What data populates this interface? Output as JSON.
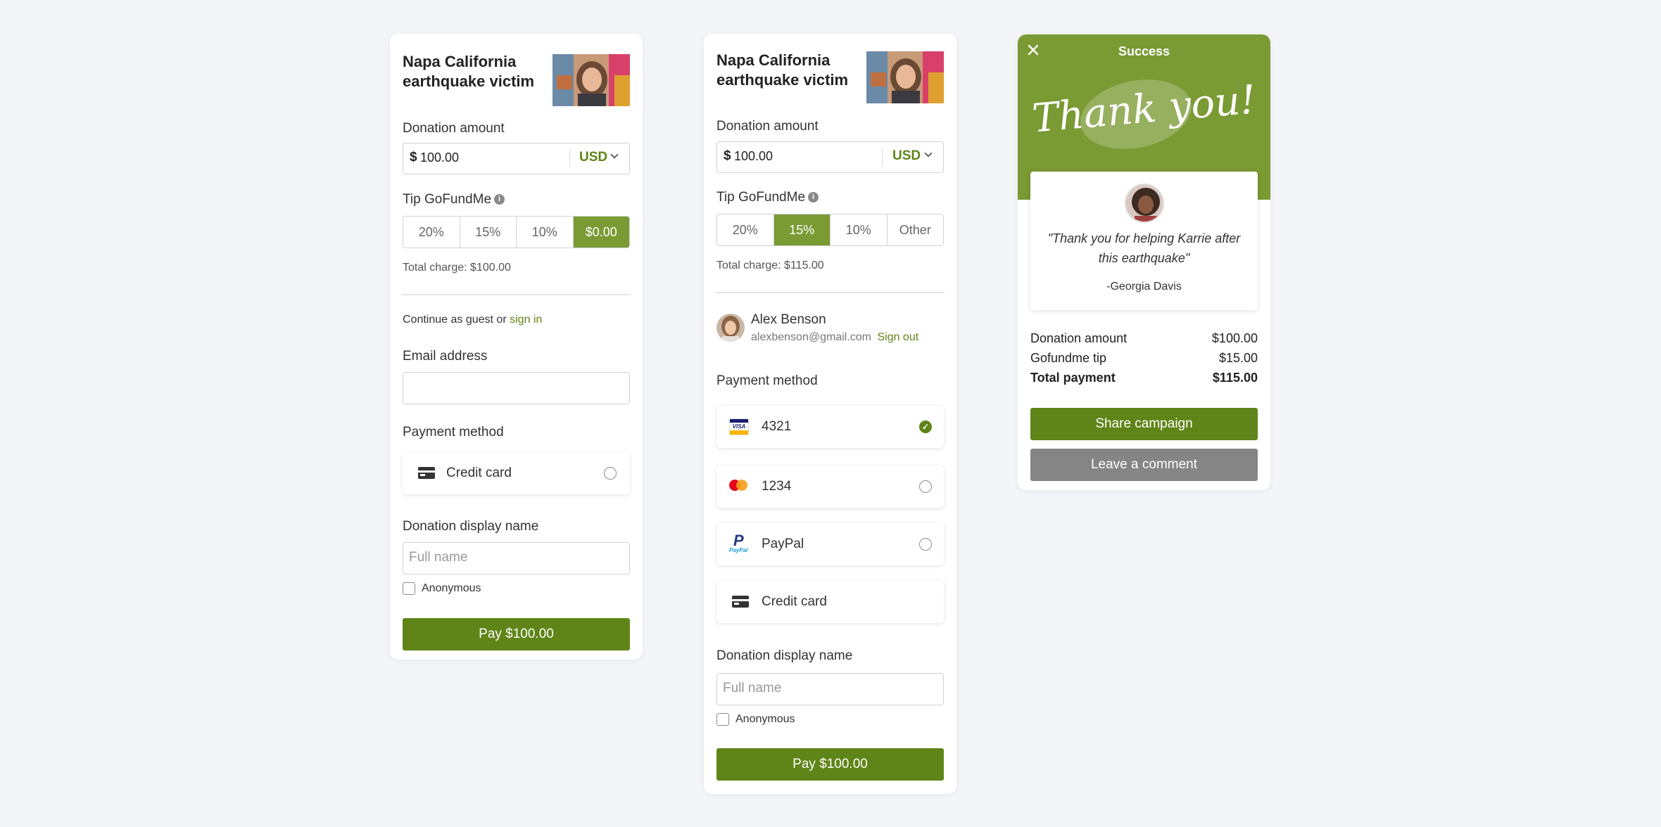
{
  "panel1": {
    "title_line1": "Napa California",
    "title_line2": "earthquake victim",
    "donation_label": "Donation amount",
    "currency_symbol": "$",
    "amount": "100.00",
    "currency": "USD",
    "tip_label": "Tip GoFundMe",
    "tips": [
      "20%",
      "15%",
      "10%",
      "$0.00"
    ],
    "selected_tip": 3,
    "total_charge": "Total charge: $100.00",
    "continue_text": "Continue as guest or",
    "sign_in": "sign in",
    "email_label": "Email address",
    "email_value": "",
    "payment_label": "Payment method",
    "payment_option": "Credit card",
    "display_name_label": "Donation display name",
    "full_name_placeholder": "Full name",
    "anonymous": "Anonymous",
    "pay_button": "Pay $100.00"
  },
  "panel2": {
    "title_line1": "Napa California",
    "title_line2": "earthquake victim",
    "donation_label": "Donation amount",
    "currency_symbol": "$",
    "amount": "100.00",
    "currency": "USD",
    "tip_label": "Tip GoFundMe",
    "tips": [
      "20%",
      "15%",
      "10%",
      "Other"
    ],
    "selected_tip": 1,
    "total_charge": "Total charge: $115.00",
    "user_name": "Alex Benson",
    "user_email": "alexbenson@gmail.com",
    "sign_out": "Sign out",
    "payment_label": "Payment method",
    "payment_methods": [
      {
        "label": "4321",
        "icon": "visa-icon",
        "selected": true
      },
      {
        "label": "1234",
        "icon": "mastercard-icon",
        "selected": false
      },
      {
        "label": "PayPal",
        "icon": "paypal-icon",
        "selected": false
      },
      {
        "label": "Credit card",
        "icon": "credit-card-icon",
        "selected": false
      }
    ],
    "display_name_label": "Donation display name",
    "full_name_placeholder": "Full name",
    "anonymous": "Anonymous",
    "pay_button": "Pay $100.00"
  },
  "panel3": {
    "header_title": "Success",
    "thank_you": "Thank you!",
    "quote": "\"Thank you for helping Karrie after this earthquake\"",
    "quote_author": "-Georgia Davis",
    "summary": [
      {
        "label": "Donation amount",
        "value": "$100.00"
      },
      {
        "label": "Gofundme tip",
        "value": "$15.00"
      },
      {
        "label": "Total payment",
        "value": "$115.00"
      }
    ],
    "share_button": "Share campaign",
    "comment_button": "Leave a comment"
  },
  "colors": {
    "brand_green": "#5f8418",
    "tip_selected": "#7a9a34",
    "success_header": "#7a9a34",
    "secondary_button": "#858585",
    "background": "#f4f5f9"
  }
}
